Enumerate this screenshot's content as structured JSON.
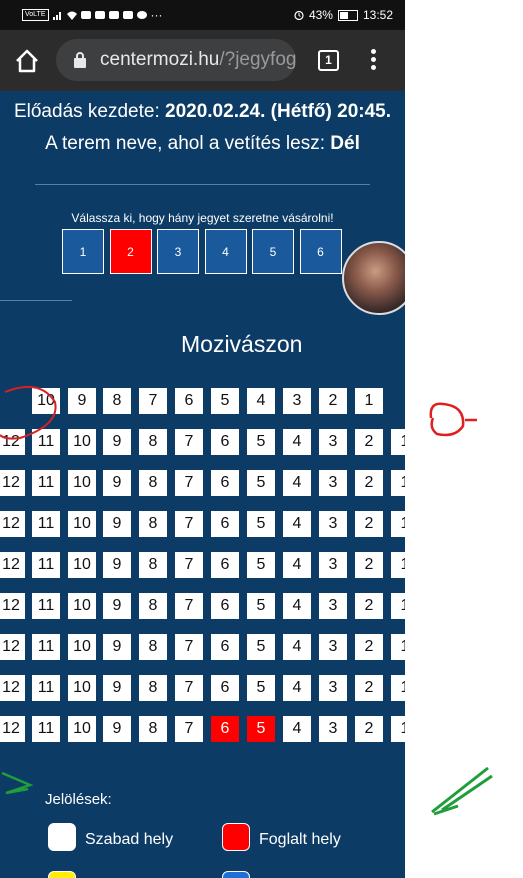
{
  "status_bar": {
    "network": "VoLTE",
    "battery_percent": "43%",
    "time": "13:52"
  },
  "browser": {
    "url_host": "centermozi.hu",
    "url_path": "/?jegyfog",
    "tab_count": "1"
  },
  "showing": {
    "start_label": "Előadás kezdete:",
    "start_value": "2020.02.24. (Hétfő) 20:45.",
    "room_label": "A terem neve, ahol a vetítés lesz:",
    "room_value": "Dél"
  },
  "ticket_qty": {
    "prompt": "Válassza ki, hogy hány jegyet szeretne vásárolni!",
    "options": [
      "1",
      "2",
      "3",
      "4",
      "5",
      "6"
    ],
    "selected": "2"
  },
  "screen_label": "Mozivászon",
  "seat_rows": [
    [
      "10",
      "9",
      "8",
      "7",
      "6",
      "5",
      "4",
      "3",
      "2",
      "1"
    ],
    [
      "12",
      "11",
      "10",
      "9",
      "8",
      "7",
      "6",
      "5",
      "4",
      "3",
      "2",
      "1"
    ],
    [
      "12",
      "11",
      "10",
      "9",
      "8",
      "7",
      "6",
      "5",
      "4",
      "3",
      "2",
      "1"
    ],
    [
      "12",
      "11",
      "10",
      "9",
      "8",
      "7",
      "6",
      "5",
      "4",
      "3",
      "2",
      "1"
    ],
    [
      "12",
      "11",
      "10",
      "9",
      "8",
      "7",
      "6",
      "5",
      "4",
      "3",
      "2",
      "1"
    ],
    [
      "12",
      "11",
      "10",
      "9",
      "8",
      "7",
      "6",
      "5",
      "4",
      "3",
      "2",
      "1"
    ],
    [
      "12",
      "11",
      "10",
      "9",
      "8",
      "7",
      "6",
      "5",
      "4",
      "3",
      "2",
      "1"
    ],
    [
      "12",
      "11",
      "10",
      "9",
      "8",
      "7",
      "6",
      "5",
      "4",
      "3",
      "2",
      "1"
    ],
    [
      "12",
      "11",
      "10",
      "9",
      "8",
      "7",
      "6",
      "5",
      "4",
      "3",
      "2",
      "1"
    ]
  ],
  "taken_seats": [
    {
      "row_index": 8,
      "seat": "6"
    },
    {
      "row_index": 8,
      "seat": "5"
    }
  ],
  "legend": {
    "title": "Jelölések:",
    "free_label": "Szabad hely",
    "taken_label": "Foglalt hely"
  },
  "colors": {
    "page_bg": "#0c3c66",
    "seat_free": "#ffffff",
    "seat_taken": "#ff0000",
    "qty_button": "#1a5a9c",
    "legend_yellow": "#ffee00",
    "legend_blue": "#1e6fd6"
  }
}
